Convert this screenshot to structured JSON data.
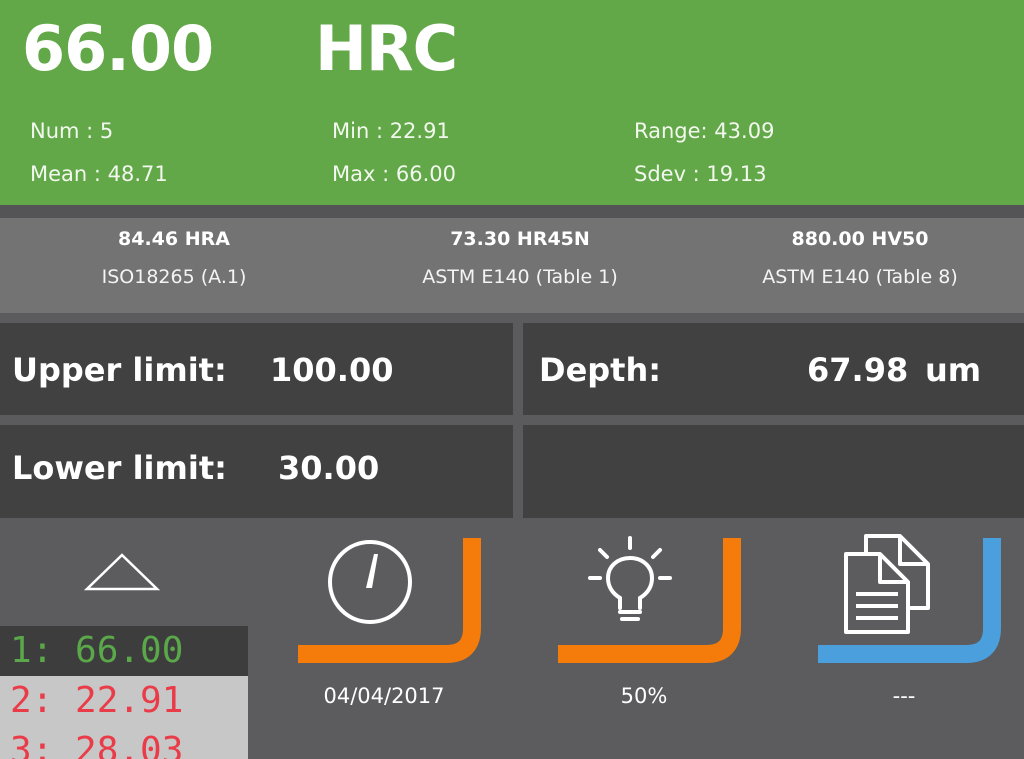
{
  "reading": {
    "value": "66.00",
    "unit": "HRC"
  },
  "stats": {
    "num": "Num  : 5",
    "mean": "Mean : 48.71",
    "min": "Min  : 22.91",
    "max": "Max  : 66.00",
    "range": "Range: 43.09",
    "sdev": "Sdev : 19.13"
  },
  "conversions": [
    {
      "value": "84.46 HRA",
      "standard": "ISO18265 (A.1)"
    },
    {
      "value": "73.30 HR45N",
      "standard": "ASTM E140 (Table 1)"
    },
    {
      "value": "880.00 HV50",
      "standard": "ASTM E140 (Table 8)"
    }
  ],
  "limits": {
    "upper_label": "Upper limit:",
    "upper_value": "100.00",
    "lower_label": "Lower limit:",
    "lower_value": "30.00"
  },
  "depth": {
    "label": "Depth:",
    "value": "67.98",
    "unit": "um"
  },
  "readings": [
    "1: 66.00",
    "2: 22.91",
    "3: 28.03"
  ],
  "tiles": {
    "date": {
      "caption": "04/04/2017",
      "icon": "clock-icon"
    },
    "light": {
      "caption": "50%",
      "icon": "lightbulb-icon"
    },
    "documents": {
      "caption": "---",
      "icon": "documents-icon"
    }
  },
  "colors": {
    "header_green": "#62a848",
    "pass_green": "#5aa84a",
    "fail_red": "#ea3c48",
    "accent_orange": "#f57c0a",
    "accent_blue": "#4a9fdc"
  }
}
